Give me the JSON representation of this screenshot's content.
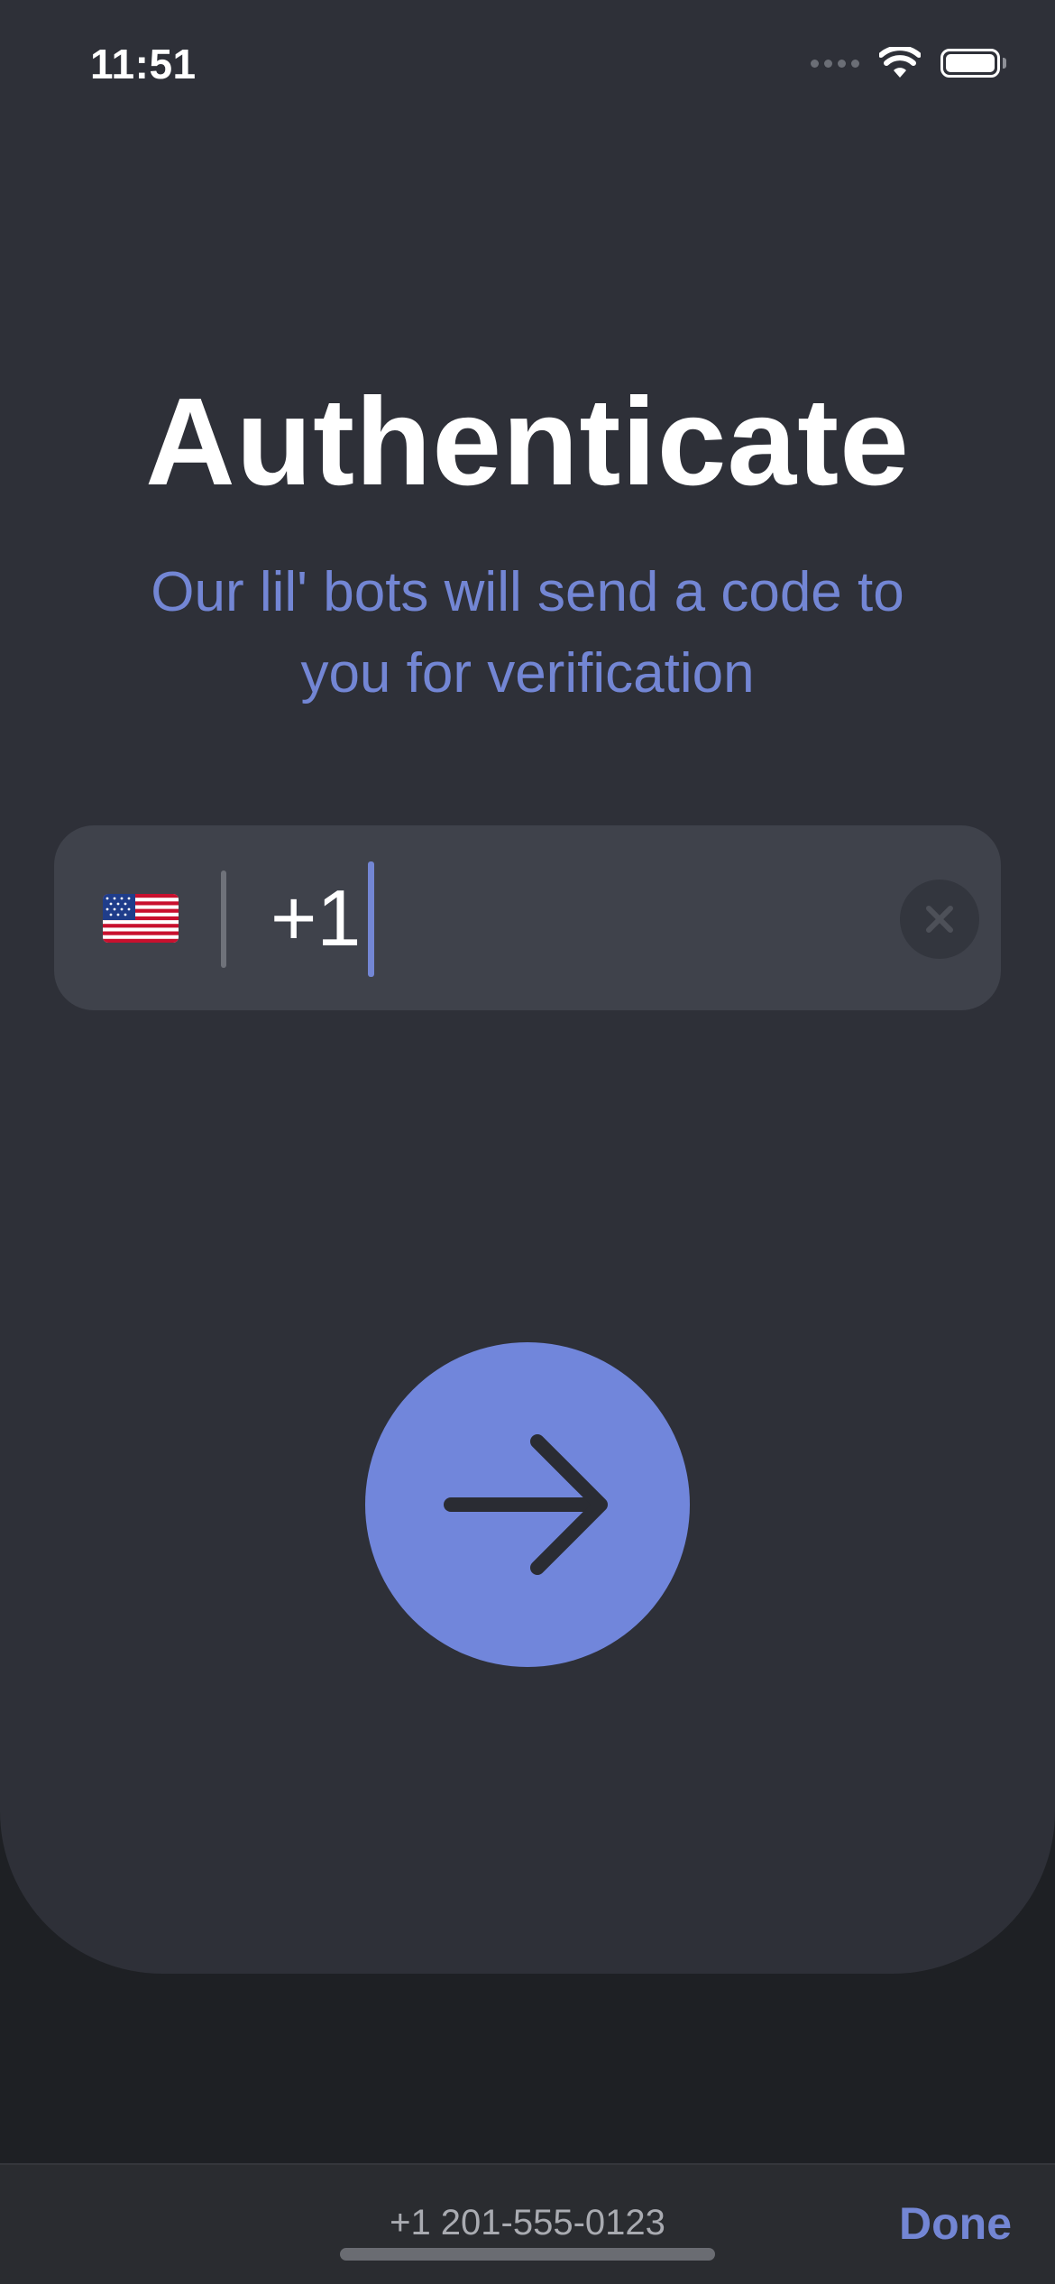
{
  "status_bar": {
    "time": "11:51",
    "icons": [
      "cellular-signal-icon",
      "wifi-icon",
      "battery-icon"
    ]
  },
  "header": {
    "title": "Authenticate",
    "subtitle": "Our lil' bots will send a code to you for verification"
  },
  "phone_input": {
    "country_flag": "flag-us-icon",
    "value": "+1",
    "clear_icon": "clear-icon"
  },
  "next_button": {
    "icon": "arrow-right-icon"
  },
  "accessory_bar": {
    "suggestion": "+1 201-555-0123",
    "done_label": "Done"
  },
  "colors": {
    "background": "#2e3038",
    "accent": "#7186db",
    "subtitle": "#7386d4",
    "input_bg": "#3f424b",
    "title": "#ffffff"
  }
}
